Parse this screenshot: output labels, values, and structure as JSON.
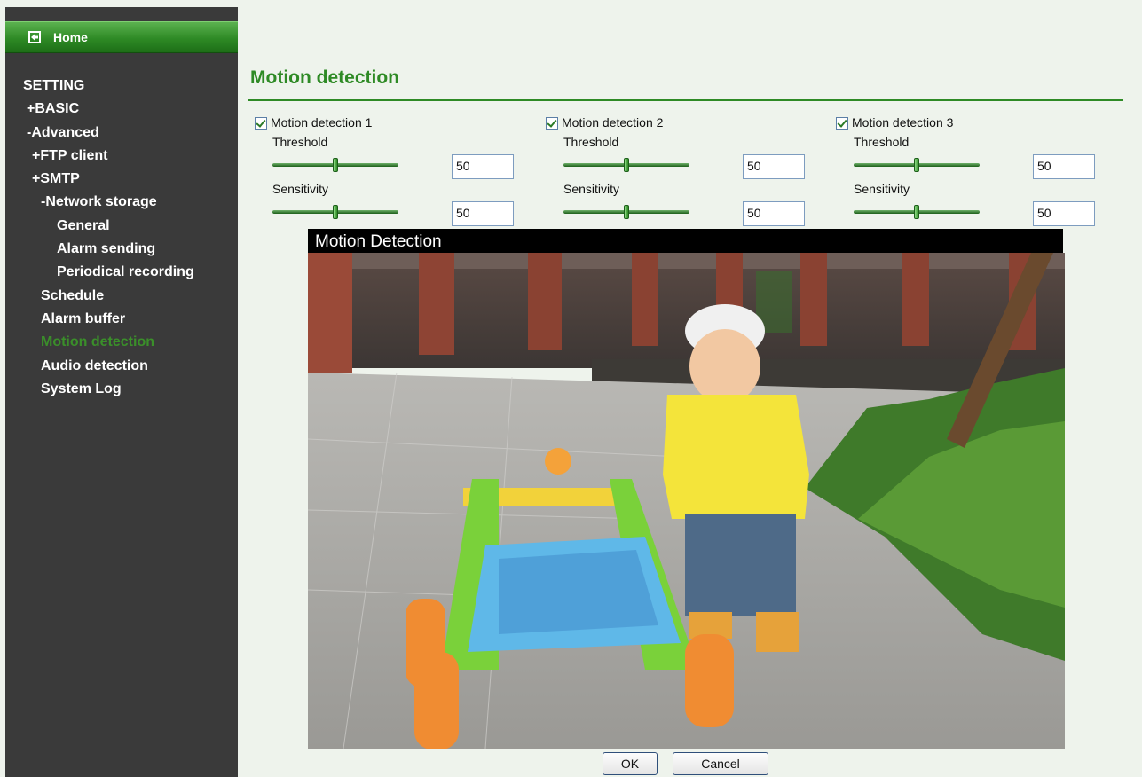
{
  "sidebar": {
    "home_label": "Home",
    "items": [
      {
        "label": "SETTING"
      },
      {
        "label": "+BASIC"
      },
      {
        "label": "-Advanced"
      },
      {
        "label": "+FTP client"
      },
      {
        "label": "+SMTP"
      },
      {
        "label": "-Network storage"
      },
      {
        "label": "General"
      },
      {
        "label": "Alarm sending"
      },
      {
        "label": "Periodical recording"
      },
      {
        "label": "Schedule"
      },
      {
        "label": "Alarm buffer"
      },
      {
        "label": "Motion detection"
      },
      {
        "label": "Audio detection"
      },
      {
        "label": "System Log"
      }
    ],
    "active_item": "Motion detection"
  },
  "page": {
    "title": "Motion detection"
  },
  "detectors": [
    {
      "name": "Motion detection 1",
      "enabled": true,
      "threshold_label": "Threshold",
      "threshold": "50",
      "sensitivity_label": "Sensitivity",
      "sensitivity": "50"
    },
    {
      "name": "Motion detection 2",
      "enabled": true,
      "threshold_label": "Threshold",
      "threshold": "50",
      "sensitivity_label": "Sensitivity",
      "sensitivity": "50"
    },
    {
      "name": "Motion detection 3",
      "enabled": true,
      "threshold_label": "Threshold",
      "threshold": "50",
      "sensitivity_label": "Sensitivity",
      "sensitivity": "50"
    }
  ],
  "video": {
    "title": "Motion Detection"
  },
  "buttons": {
    "ok_label": "OK",
    "cancel_label": "Cancel"
  },
  "colors": {
    "accent": "#2e8a25",
    "sidebar_bg": "#3a3a3a",
    "page_bg": "#eef3ec"
  }
}
